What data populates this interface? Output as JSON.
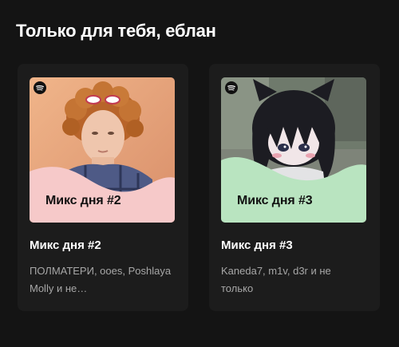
{
  "section": {
    "title": "Только для тебя, еблан"
  },
  "cards": [
    {
      "cover_label": "Микс дня #2",
      "title": "Микс дня #2",
      "description": "ПОЛМАТЕРИ, ooes, Poshlaya Molly и не…",
      "accent_color": "#f6c9c9",
      "cover_bg_color": "#e8a878"
    },
    {
      "cover_label": "Микс дня #3",
      "title": "Микс дня #3",
      "description": "Kaneda7, m1v, d3r и не только",
      "accent_color": "#b9e4c0",
      "cover_bg_color": "#6f7a6c"
    }
  ],
  "icons": {
    "brand": "spotify-icon"
  }
}
